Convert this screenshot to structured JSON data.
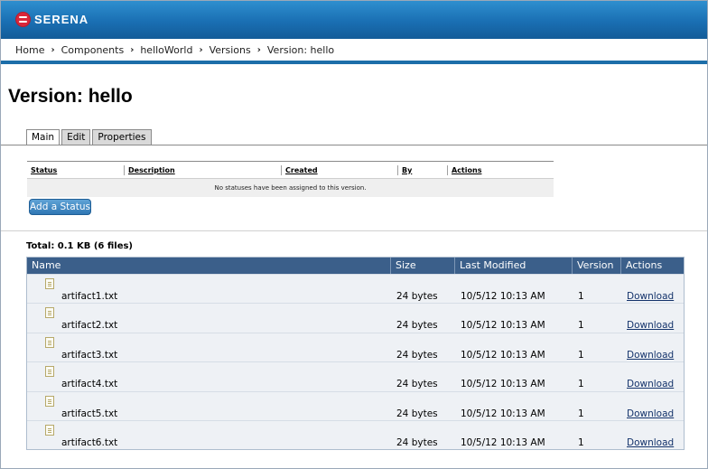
{
  "brand": {
    "name": "SERENA"
  },
  "breadcrumb": [
    {
      "label": "Home"
    },
    {
      "label": "Components"
    },
    {
      "label": "helloWorld"
    },
    {
      "label": "Versions"
    },
    {
      "label": "Version: hello"
    }
  ],
  "breadcrumb_separator": "›",
  "page": {
    "title": "Version: hello"
  },
  "tabs": [
    {
      "label": "Main",
      "active": true
    },
    {
      "label": "Edit",
      "active": false
    },
    {
      "label": "Properties",
      "active": false
    }
  ],
  "status_table": {
    "columns": [
      "Status",
      "Description",
      "Created",
      "By",
      "Actions"
    ],
    "empty_message": "No statuses have been assigned to this version."
  },
  "add_status_label": "Add a Status",
  "files": {
    "total": "Total: 0.1 KB (6 files)",
    "columns": [
      "Name",
      "Size",
      "Last Modified",
      "Version",
      "Actions"
    ],
    "rows": [
      {
        "name": "artifact1.txt",
        "size": "24 bytes",
        "modified": "10/5/12 10:13 AM",
        "version": "1",
        "action": "Download"
      },
      {
        "name": "artifact2.txt",
        "size": "24 bytes",
        "modified": "10/5/12 10:13 AM",
        "version": "1",
        "action": "Download"
      },
      {
        "name": "artifact3.txt",
        "size": "24 bytes",
        "modified": "10/5/12 10:13 AM",
        "version": "1",
        "action": "Download"
      },
      {
        "name": "artifact4.txt",
        "size": "24 bytes",
        "modified": "10/5/12 10:13 AM",
        "version": "1",
        "action": "Download"
      },
      {
        "name": "artifact5.txt",
        "size": "24 bytes",
        "modified": "10/5/12 10:13 AM",
        "version": "1",
        "action": "Download"
      },
      {
        "name": "artifact6.txt",
        "size": "24 bytes",
        "modified": "10/5/12 10:13 AM",
        "version": "1",
        "action": "Download"
      }
    ]
  },
  "colors": {
    "header_blue": "#1a6fb3",
    "table_header": "#3b5f8a",
    "button_blue": "#2f77b4"
  }
}
